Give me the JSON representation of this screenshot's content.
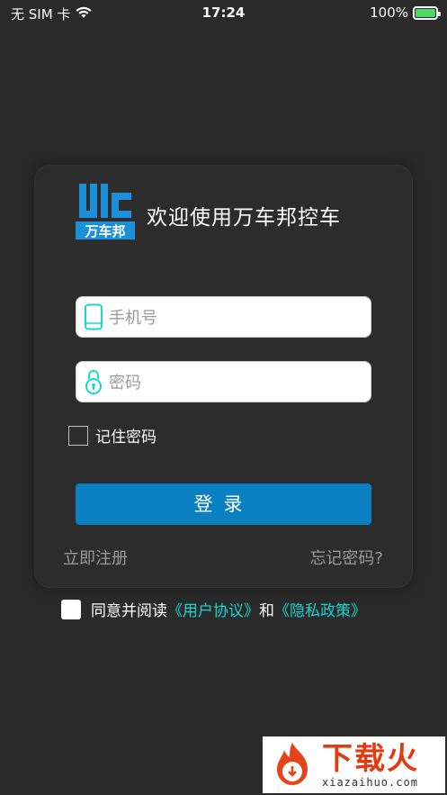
{
  "status_bar": {
    "carrier": "无 SIM 卡",
    "time": "17:24",
    "battery": "100%"
  },
  "app": {
    "logo_text": "万车邦",
    "welcome": "欢迎使用万车邦控车"
  },
  "form": {
    "phone_placeholder": "手机号",
    "password_placeholder": "密码",
    "remember_label": "记住密码",
    "login_label": "登录",
    "register_link": "立即注册",
    "forgot_link": "忘记密码?"
  },
  "agreement": {
    "prefix": "同意并阅读",
    "user_agreement": "《用户协议》",
    "conjunction": "和",
    "privacy_policy": "《隐私政策》"
  },
  "watermark": {
    "cn": "下载火",
    "en": "xiazaihuo.com"
  },
  "colors": {
    "background": "#2a2a2a",
    "accent": "#0a7fc2",
    "link": "#18d6d1",
    "icon": "#18d6d1"
  }
}
